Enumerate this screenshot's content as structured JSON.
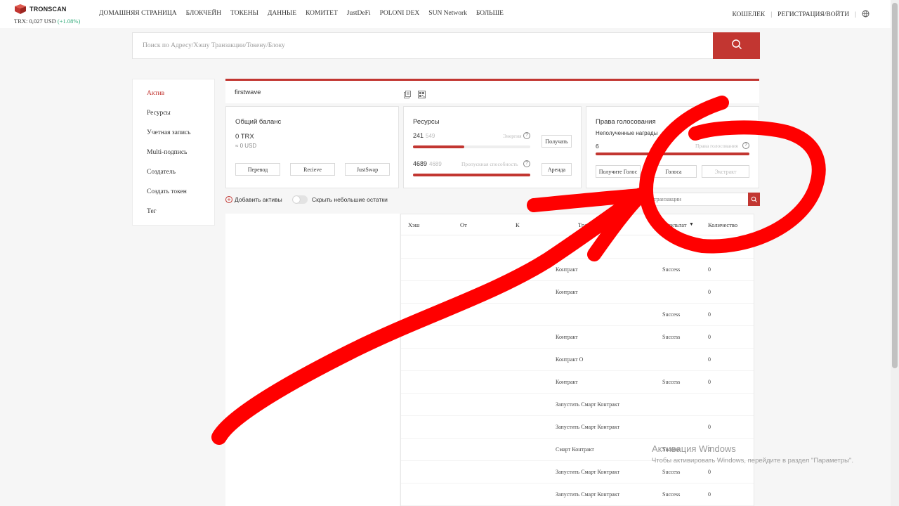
{
  "header": {
    "logo": "TRONSCAN",
    "price_label": "TRX: 0,027 USD",
    "price_change": "(+1.08%)",
    "nav": [
      "ДОМАШНЯЯ СТРАНИЦА",
      "БЛОКЧЕЙН",
      "ТОКЕНЫ",
      "ДАННЫЕ",
      "КОМИТЕТ",
      "JustDeFi",
      "POLONI DEX",
      "SUN Network",
      "БОЛЬШЕ"
    ],
    "wallet": "КОШЕЛЕК",
    "auth": "РЕГИСТРАЦИЯ/ВОЙТИ",
    "separator": "|",
    "accent": "#c23631"
  },
  "search": {
    "placeholder": "Поиск по Адресу/Хэшу Транзакции/Токену/Блоку"
  },
  "sidebar": {
    "items": [
      "Актив",
      "Ресурсы",
      "Учетная запись",
      "Multi-подпись",
      "Создатель",
      "Создать токен",
      "Тег"
    ]
  },
  "account": {
    "name": "firstwave"
  },
  "balance": {
    "title": "Общий баланс",
    "value": "0 TRX",
    "usd": "≈ 0 USD",
    "buttons": [
      "Перевод",
      "Recieve",
      "JustSwap"
    ]
  },
  "resources": {
    "title": "Ресурсы",
    "energy_value": "241",
    "energy_max": "549",
    "energy_label": "Энергия",
    "energy_fraction": 0.44,
    "bandwidth_value": "4689",
    "bandwidth_max": "4689",
    "bandwidth_label": "Пропускная способность",
    "bandwidth_fraction": 1.0,
    "get_button": "Получать",
    "rent_button": "Аренда"
  },
  "voting": {
    "title": "Права голосования",
    "subtitle": "Неполученные награды",
    "value": "6",
    "rights_label": "Права голосования",
    "buttons": [
      "Получите Голос",
      "Голоса",
      "Экстракт"
    ]
  },
  "assets": {
    "add_label": "Добавить активы",
    "hide_small": "Скрыть небольшие остатки"
  },
  "tx_search": {
    "placeholder": "транзакции"
  },
  "table": {
    "headers": [
      "Хэш",
      "От",
      "К",
      "Транзакция",
      "Результат",
      "Количество"
    ],
    "sort_icon": "▼",
    "rows": [
      {
        "type": "",
        "result": "",
        "amount": ""
      },
      {
        "type": "Контракт",
        "result": "Success",
        "amount": "0"
      },
      {
        "type": "Контракт",
        "result": "",
        "amount": "0"
      },
      {
        "type": "",
        "result": "Success",
        "amount": "0"
      },
      {
        "type": "Контракт",
        "result": "Success",
        "amount": "0"
      },
      {
        "type": "Контракт О",
        "result": "",
        "amount": "0"
      },
      {
        "type": "Контракт",
        "result": "Success",
        "amount": "0"
      },
      {
        "type": "Запустить Смарт Контракт",
        "result": "",
        "amount": ""
      },
      {
        "type": "Запустить Смарт Контракт",
        "result": "",
        "amount": "0"
      },
      {
        "type": "Смарт Контракт",
        "result": "Success",
        "amount": "0"
      },
      {
        "type": "Запустить Смарт Контракт",
        "result": "Success",
        "amount": "0"
      },
      {
        "type": "Запустить Смарт Контракт",
        "result": "Success",
        "amount": "0"
      }
    ]
  },
  "watermark": {
    "title": "Активация Windows",
    "subtitle": "Чтобы активировать Windows, перейдите в раздел \"Параметры\"."
  },
  "annotation_color": "#ff0000"
}
